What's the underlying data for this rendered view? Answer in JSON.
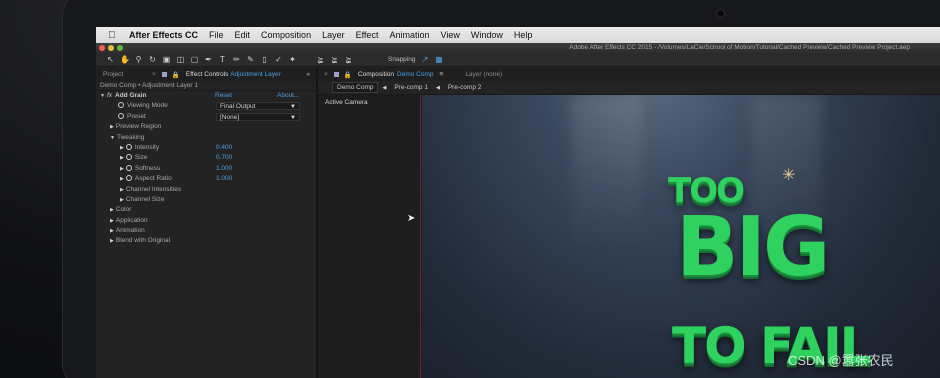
{
  "menubar": {
    "app": "After Effects CC",
    "items": [
      "File",
      "Edit",
      "Composition",
      "Layer",
      "Effect",
      "Animation",
      "View",
      "Window",
      "Help"
    ]
  },
  "window_title": "Adobe After Effects CC 2015 - /Volumes/LaCie/School of Motion/Tutorial/Cached Preview/Cached Preview Project.aep",
  "toolbar": {
    "snapping": "Snapping"
  },
  "left_panel": {
    "tab_project": "Project",
    "tab_effect_controls": "Effect Controls",
    "tab_layer": "Adjustment Layer",
    "header": "Demo Comp • Adjustment Layer 1",
    "effect": {
      "name": "Add Grain",
      "reset": "Reset",
      "about": "About...",
      "viewing_mode_label": "Viewing Mode",
      "viewing_mode_value": "Final Output",
      "preset_label": "Preset",
      "preset_value": "[None]",
      "preview_region": "Preview Region",
      "tweaking": "Tweaking",
      "intensity_label": "Intensity",
      "intensity_value": "0.400",
      "size_label": "Size",
      "size_value": "0.700",
      "softness_label": "Softness",
      "softness_value": "1.000",
      "aspect_label": "Aspect Ratio",
      "aspect_value": "1.000",
      "channel_intensities": "Channel Intensities",
      "channel_size": "Channel Size",
      "color": "Color",
      "application": "Application",
      "animation": "Animation",
      "blend": "Blend with Original"
    }
  },
  "comp_panel": {
    "tab_label": "Composition",
    "comp_name": "Demo Comp",
    "layer_tab": "Layer (none)",
    "breadcrumbs": [
      "Demo Comp",
      "Pre-comp 1",
      "Pre-comp 2"
    ],
    "camera_label": "Active Camera",
    "title_lines": [
      "TOO",
      "BIG",
      "TO FAIL"
    ]
  },
  "watermark": "CSDN @嚣张农民"
}
